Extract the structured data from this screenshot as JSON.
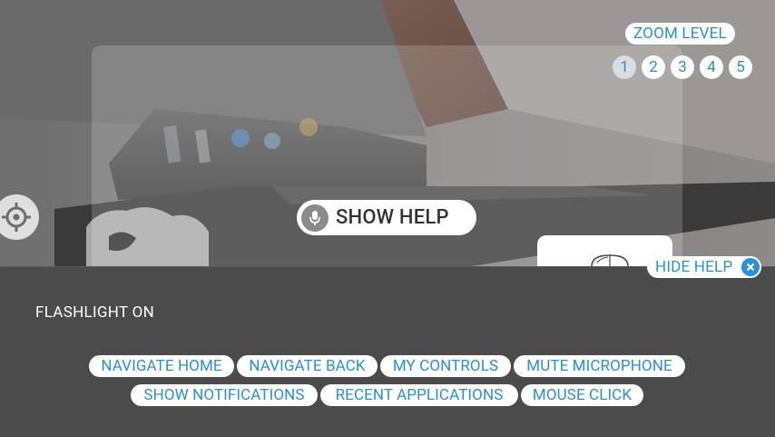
{
  "zoom": {
    "label": "ZOOM LEVEL",
    "levels": [
      "1",
      "2",
      "3",
      "4",
      "5"
    ],
    "selected": "1"
  },
  "voice": {
    "show_help_label": "SHOW HELP",
    "icon": "microphone-icon"
  },
  "help_panel": {
    "hide_help_label": "HIDE HELP",
    "flashlight_status": "FLASHLIGHT ON",
    "commands": [
      "NAVIGATE HOME",
      "NAVIGATE BACK",
      "MY CONTROLS",
      "MUTE MICROPHONE",
      "SHOW NOTIFICATIONS",
      "RECENT APPLICATIONS",
      "MOUSE CLICK"
    ]
  },
  "colors": {
    "accent": "#2a8fd6",
    "panel_bg": "#4b4b4b",
    "pill_bg": "#ffffff"
  }
}
